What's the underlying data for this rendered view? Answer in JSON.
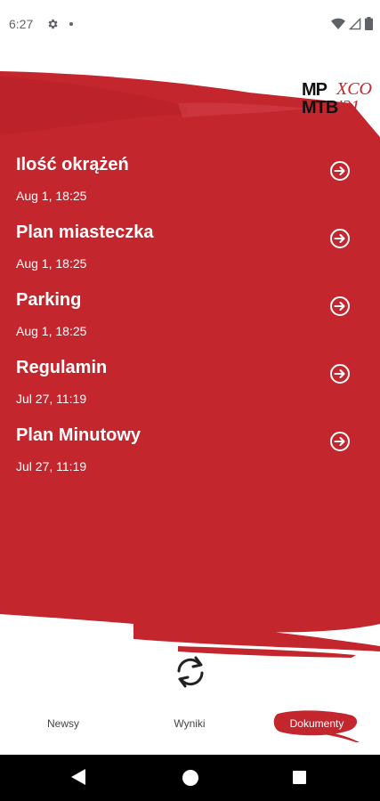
{
  "status_bar": {
    "time": "6:27"
  },
  "logo": {
    "line1": "MP",
    "line2": "MTB",
    "accent1": "XCO",
    "accent2": "'21"
  },
  "documents": [
    {
      "title": "Ilość okrążeń",
      "date": "Aug 1, 18:25"
    },
    {
      "title": "Plan miasteczka",
      "date": "Aug 1, 18:25"
    },
    {
      "title": "Parking",
      "date": "Aug 1, 18:25"
    },
    {
      "title": "Regulamin",
      "date": "Jul 27, 11:19"
    },
    {
      "title": "Plan Minutowy",
      "date": "Jul 27, 11:19"
    }
  ],
  "tabs": [
    {
      "label": "Newsy",
      "active": false
    },
    {
      "label": "Wyniki",
      "active": false
    },
    {
      "label": "Dokumenty",
      "active": true
    }
  ],
  "colors": {
    "brand_red": "#c4262e",
    "text_dark": "#111111"
  },
  "icons": {
    "doc_action": "arrow-circle-right-icon",
    "refresh": "refresh-icon"
  }
}
